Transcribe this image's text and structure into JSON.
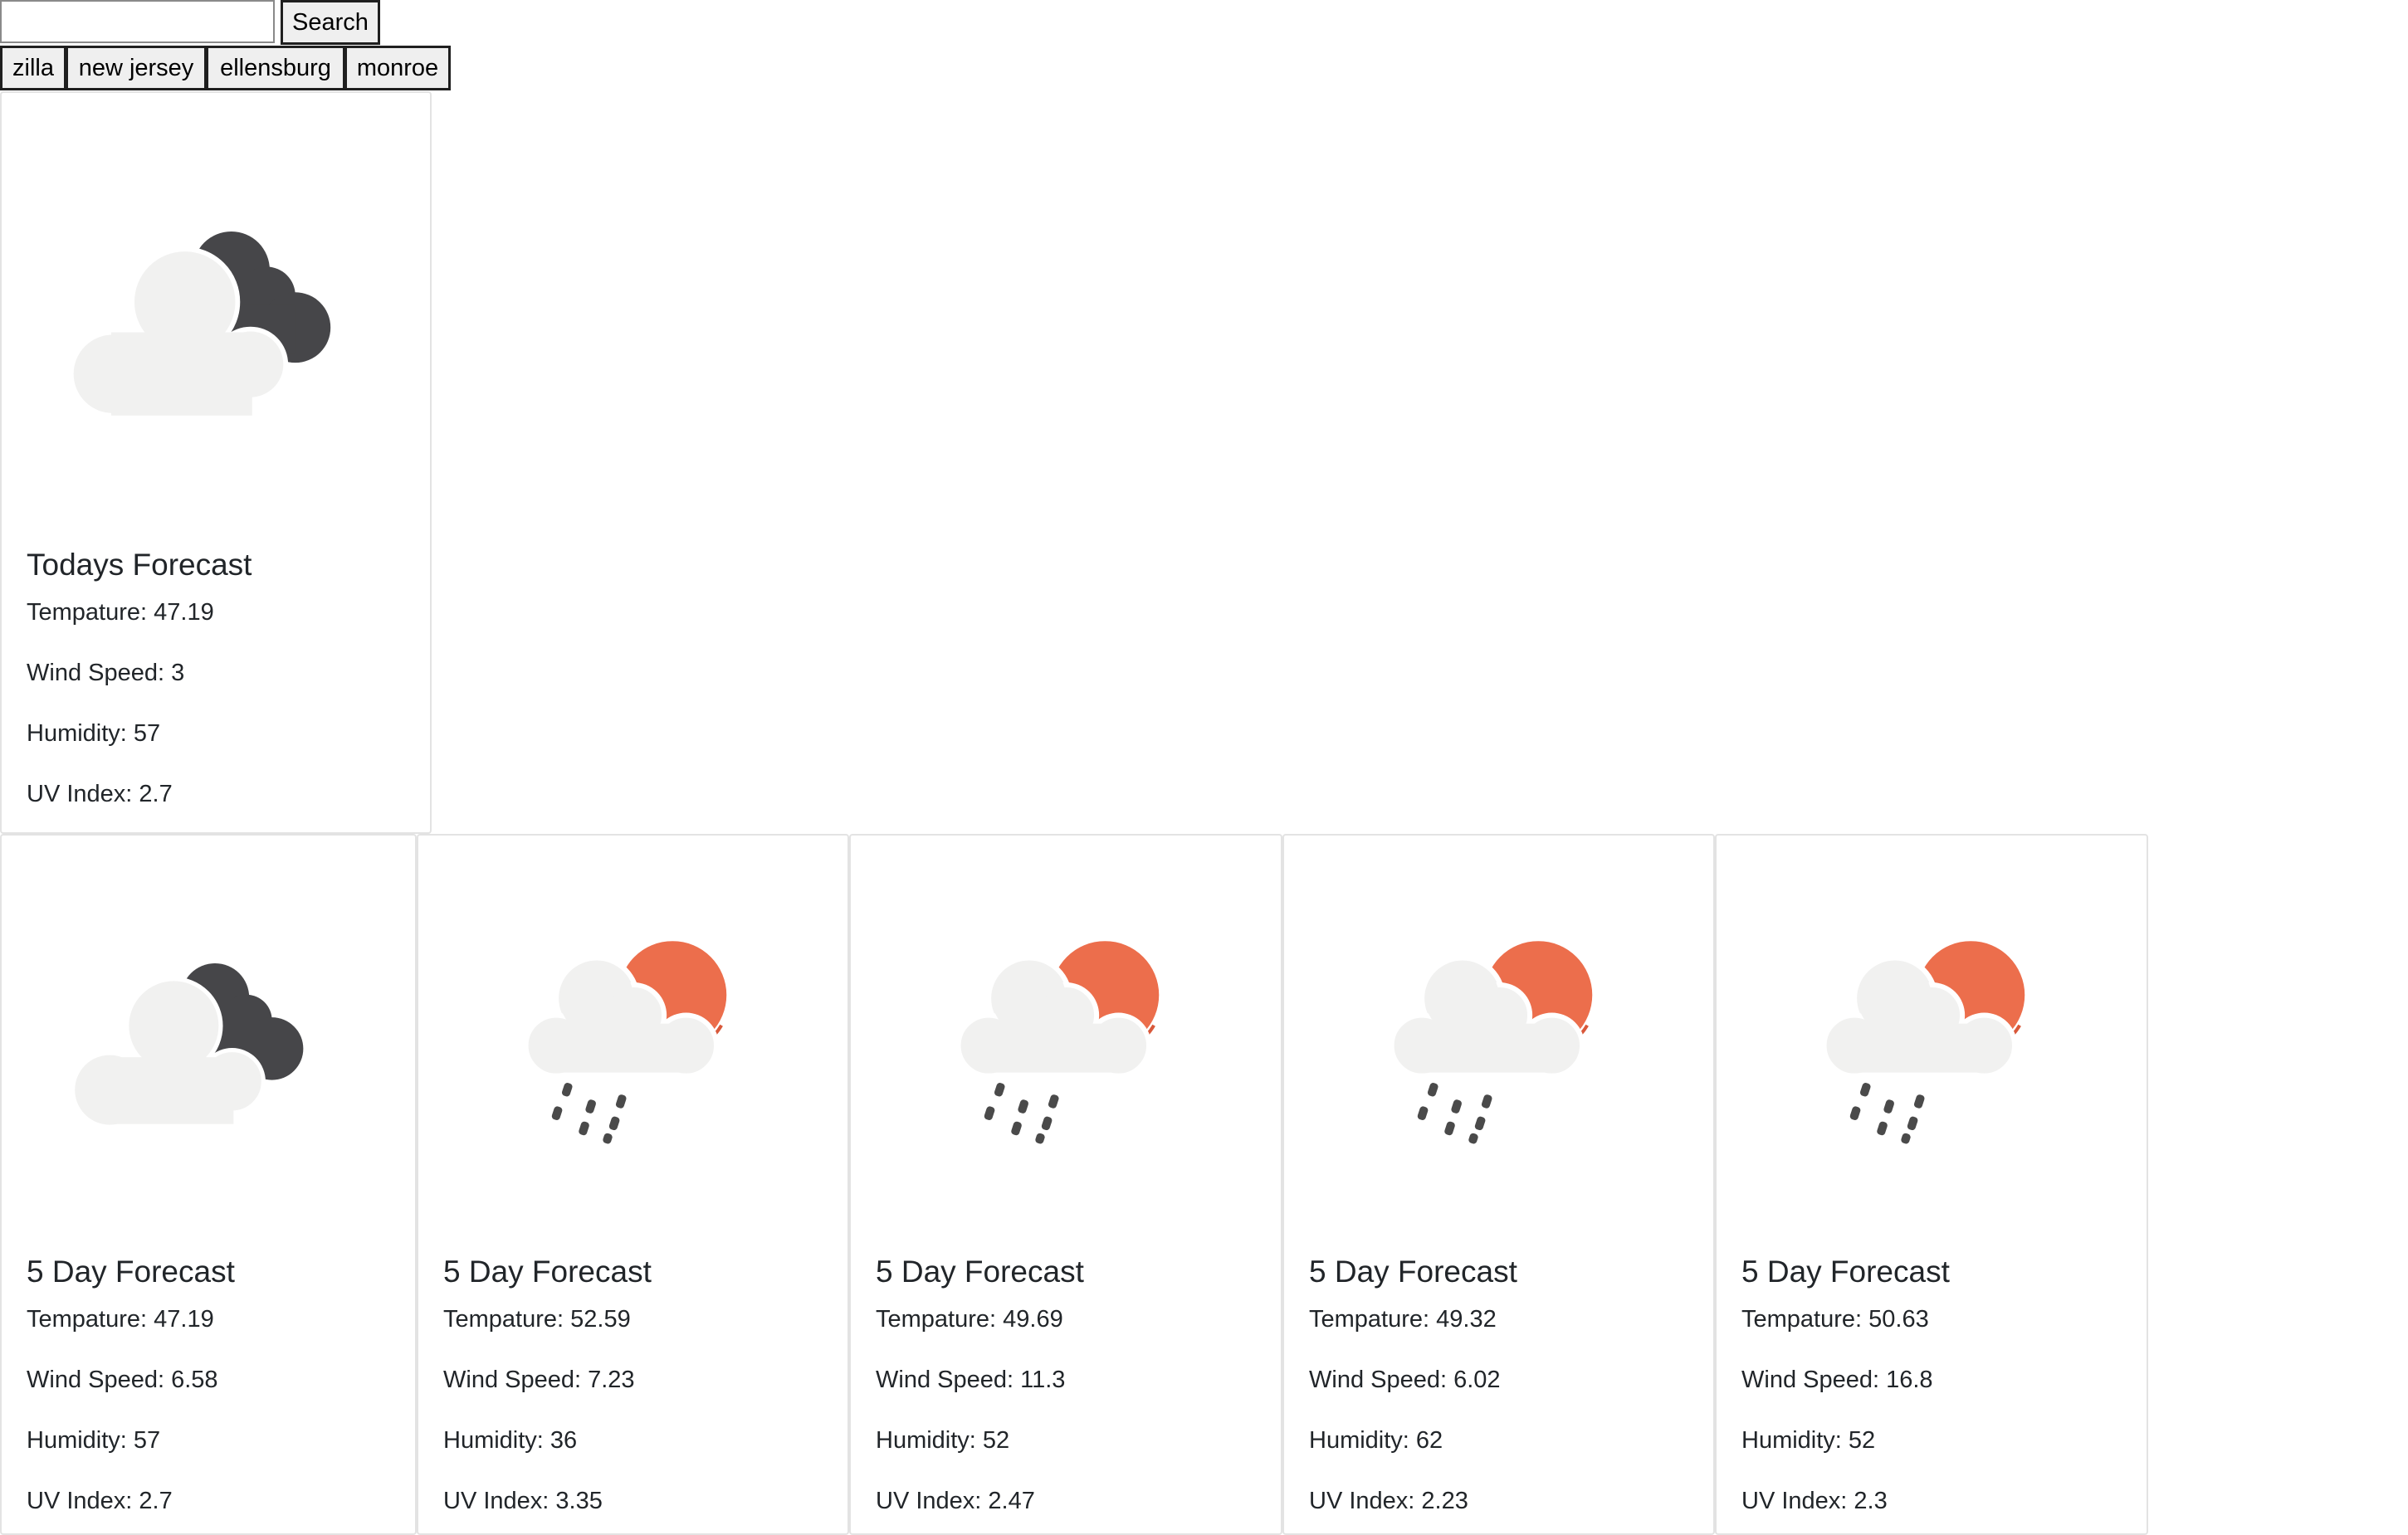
{
  "search": {
    "placeholder": "",
    "value": "",
    "button_label": "Search"
  },
  "history": [
    "zilla",
    "new jersey",
    "ellensburg",
    "monroe"
  ],
  "today": {
    "icon": "cloudy-night-icon",
    "title": "Todays Forecast",
    "temperature_label": "Tempature:",
    "temperature": "47.19",
    "wind_label": "Wind Speed:",
    "wind": "3",
    "humidity_label": "Humidity:",
    "humidity": "57",
    "uv_label": "UV Index:",
    "uv": "2.7"
  },
  "forecast": [
    {
      "icon": "cloudy-night-icon",
      "title": "5 Day Forecast",
      "temperature_label": "Tempature:",
      "temperature": "47.19",
      "wind_label": "Wind Speed:",
      "wind": "6.58",
      "humidity_label": "Humidity:",
      "humidity": "57",
      "uv_label": "UV Index:",
      "uv": "2.7"
    },
    {
      "icon": "sun-rain-icon",
      "title": "5 Day Forecast",
      "temperature_label": "Tempature:",
      "temperature": "52.59",
      "wind_label": "Wind Speed:",
      "wind": "7.23",
      "humidity_label": "Humidity:",
      "humidity": "36",
      "uv_label": "UV Index:",
      "uv": "3.35"
    },
    {
      "icon": "sun-rain-icon",
      "title": "5 Day Forecast",
      "temperature_label": "Tempature:",
      "temperature": "49.69",
      "wind_label": "Wind Speed:",
      "wind": "11.3",
      "humidity_label": "Humidity:",
      "humidity": "52",
      "uv_label": "UV Index:",
      "uv": "2.47"
    },
    {
      "icon": "sun-rain-icon",
      "title": "5 Day Forecast",
      "temperature_label": "Tempature:",
      "temperature": "49.32",
      "wind_label": "Wind Speed:",
      "wind": "6.02",
      "humidity_label": "Humidity:",
      "humidity": "62",
      "uv_label": "UV Index:",
      "uv": "2.23"
    },
    {
      "icon": "sun-rain-icon",
      "title": "5 Day Forecast",
      "temperature_label": "Tempature:",
      "temperature": "50.63",
      "wind_label": "Wind Speed:",
      "wind": "16.8",
      "humidity_label": "Humidity:",
      "humidity": "52",
      "uv_label": "UV Index:",
      "uv": "2.3"
    }
  ],
  "colors": {
    "cloud": "#f1f1f0",
    "dark_cloud": "#464649",
    "sun": "#ec6e4c",
    "sun_edge": "#d9583a",
    "rain": "#4a4a4a"
  }
}
